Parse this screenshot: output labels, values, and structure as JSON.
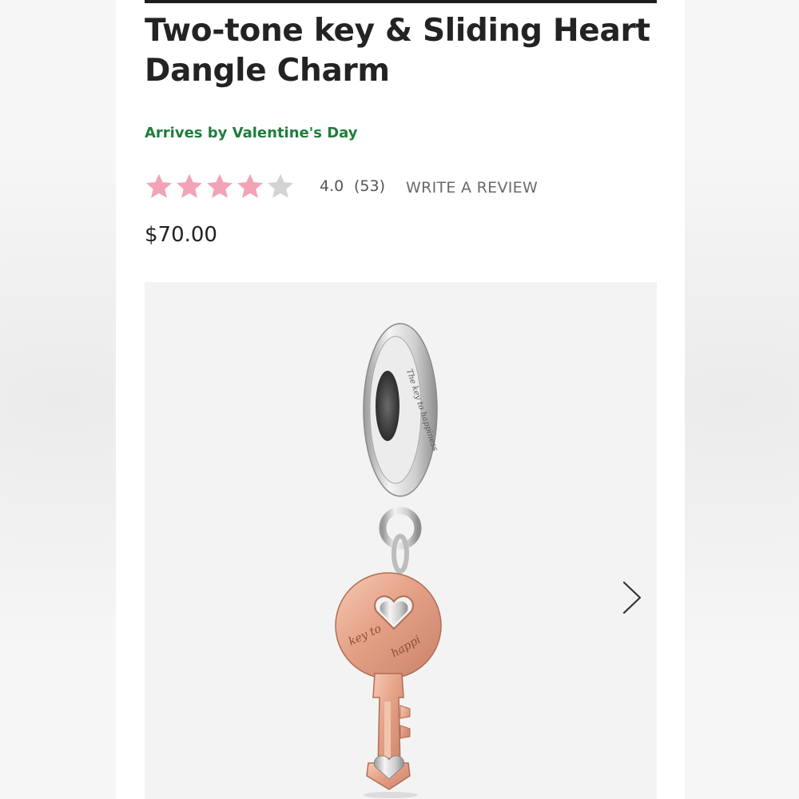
{
  "product": {
    "title": "Two-tone key & Sliding Heart Dangle Charm",
    "arrival_note": "Arrives by Valentine's Day",
    "price": "$70.00",
    "image_alt": "Two-tone key and sliding heart dangle charm"
  },
  "rating": {
    "value": 4.0,
    "value_text": "4.0",
    "max": 5,
    "count_text": "(53)",
    "write_review_label": "WRITE A REVIEW",
    "filled_color": "#f2a3b6",
    "empty_color": "#d3d3d3"
  },
  "charm_engravings": {
    "bail": "The key to happiness",
    "key_head": "The key to happiness"
  },
  "gallery": {
    "next_icon": "chevron-right-icon"
  },
  "colors": {
    "accent_green": "#1f7d3c",
    "title": "#232323",
    "rose_gold": "#e8a98e",
    "silver": "#d9d9d9"
  }
}
